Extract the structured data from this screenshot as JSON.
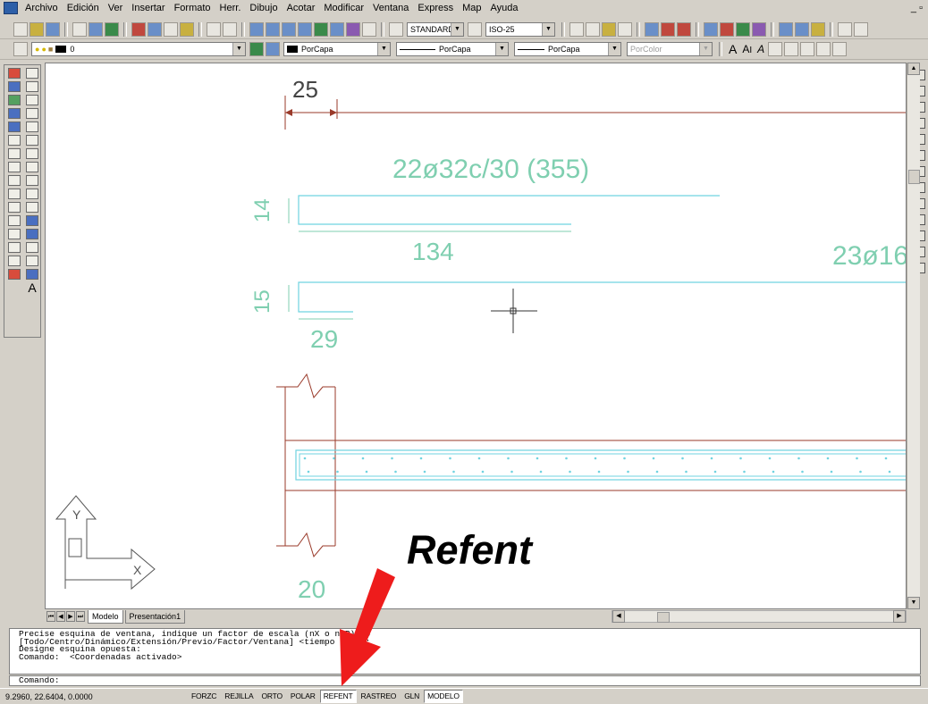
{
  "menu": {
    "items": [
      "Archivo",
      "Edición",
      "Ver",
      "Insertar",
      "Formato",
      "Herr.",
      "Dibujo",
      "Acotar",
      "Modificar",
      "Ventana",
      "Express",
      "Map",
      "Ayuda"
    ]
  },
  "toolbar": {
    "text_style": "STANDARD",
    "dim_style": "ISO-25"
  },
  "properties": {
    "layer": "0",
    "color": "PorCapa",
    "linetype": "PorCapa",
    "lineweight": "PorCapa",
    "plotstyle": "PorColor"
  },
  "drawing": {
    "dim_25": "25",
    "rebar_label_1": "22ø32c/30 (355)",
    "dim_14": "14",
    "dim_134": "134",
    "rebar_label_2": "23ø16",
    "dim_15": "15",
    "dim_29": "29",
    "dim_20": "20",
    "ucs_y": "Y",
    "ucs_x": "X"
  },
  "tabs": {
    "model": "Modelo",
    "layout1": "Presentación1"
  },
  "command": {
    "line1": "Precise esquina de ventana, indique un factor de escala (nX o nXP), o",
    "line2": "[Todo/Centro/Dinámico/Extensión/Previo/Factor/Ventana] <tiempo real>:",
    "line3": "Designe esquina opuesta:",
    "line4": "Comando:  <Coordenadas activado>",
    "prompt": "Comando:"
  },
  "status": {
    "coordinates": "9.2960, 22.6404, 0.0000",
    "toggles": [
      {
        "label": "FORZC",
        "on": false
      },
      {
        "label": "REJILLA",
        "on": false
      },
      {
        "label": "ORTO",
        "on": false
      },
      {
        "label": "POLAR",
        "on": false
      },
      {
        "label": "REFENT",
        "on": true
      },
      {
        "label": "RASTREO",
        "on": false
      },
      {
        "label": "GLN",
        "on": false
      },
      {
        "label": "MODELO",
        "on": true
      }
    ]
  },
  "annotation": {
    "label": "Refent",
    "arrow_color": "#ee1c1c"
  },
  "colors": {
    "dimension_cyan": "#7fcfb0",
    "rebar_cyan": "#6fd3e0",
    "beam_red": "#9a3a2a"
  }
}
